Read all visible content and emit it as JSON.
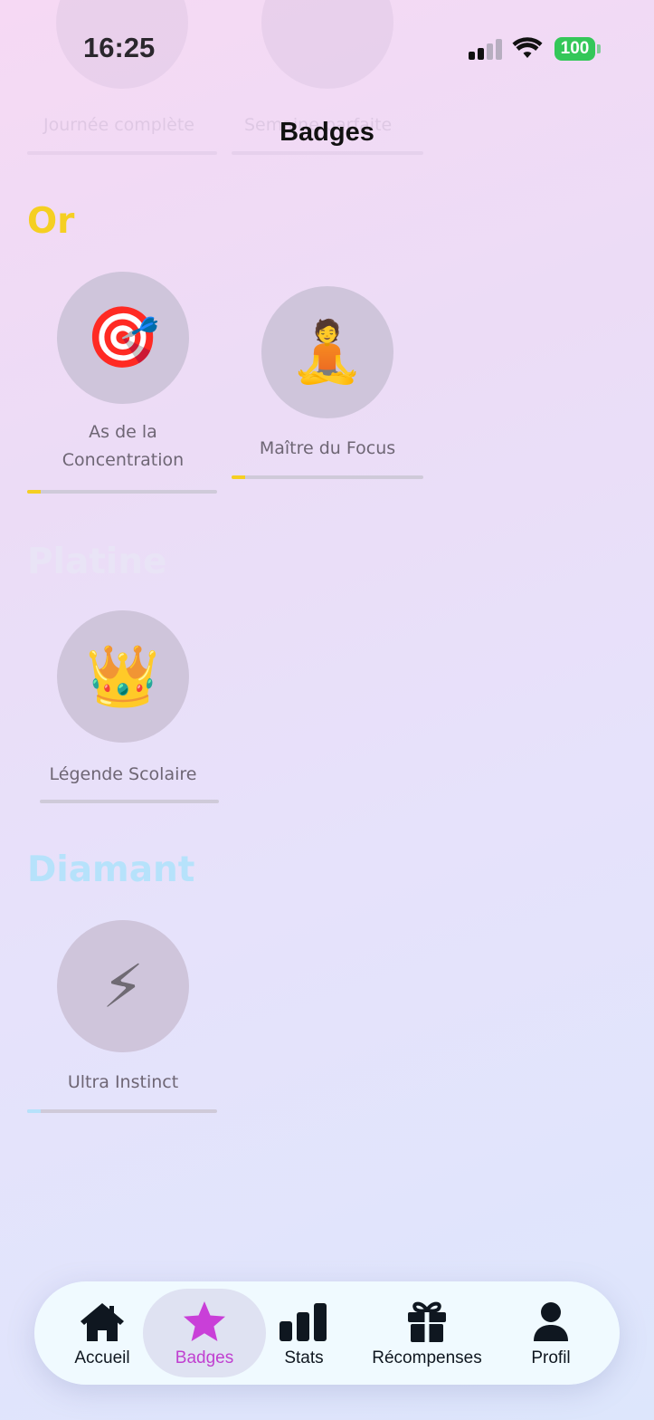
{
  "status_bar": {
    "time": "16:25",
    "battery": "100"
  },
  "ghost": {
    "left_label": "Journée complète",
    "right_label": "Semaine parfaite"
  },
  "page": {
    "title": "Badges"
  },
  "sections": [
    {
      "title": "Or",
      "color": "#f5cf22",
      "badges": [
        {
          "name_line1": "As de la",
          "name_line2": "Concentration",
          "icon": "🎯",
          "icon_name": "target-icon",
          "progress": 0.07
        },
        {
          "name": "Maître du Focus",
          "icon": "🧘",
          "icon_name": "meditation-icon",
          "progress": 0.07
        }
      ]
    },
    {
      "title": "Platine",
      "color": "#e9e4f6",
      "badges": [
        {
          "name": "Légende Scolaire",
          "icon": "👑",
          "icon_name": "crown-icon",
          "progress": 0.0
        }
      ]
    },
    {
      "title": "Diamant",
      "color": "#b6e2fb",
      "badges": [
        {
          "name": "Ultra Instinct",
          "icon": "⚡",
          "icon_name": "lightning-icon",
          "progress": 0.07
        }
      ]
    }
  ],
  "tabbar": {
    "tabs": [
      {
        "label": "Accueil",
        "icon": "home-icon",
        "active": false
      },
      {
        "label": "Badges",
        "icon": "star-icon",
        "active": true
      },
      {
        "label": "Stats",
        "icon": "bar-chart-icon",
        "active": false
      },
      {
        "label": "Récompenses",
        "icon": "gift-icon",
        "active": false
      },
      {
        "label": "Profil",
        "icon": "person-icon",
        "active": false
      }
    ],
    "accent_color": "#c93fd8"
  }
}
